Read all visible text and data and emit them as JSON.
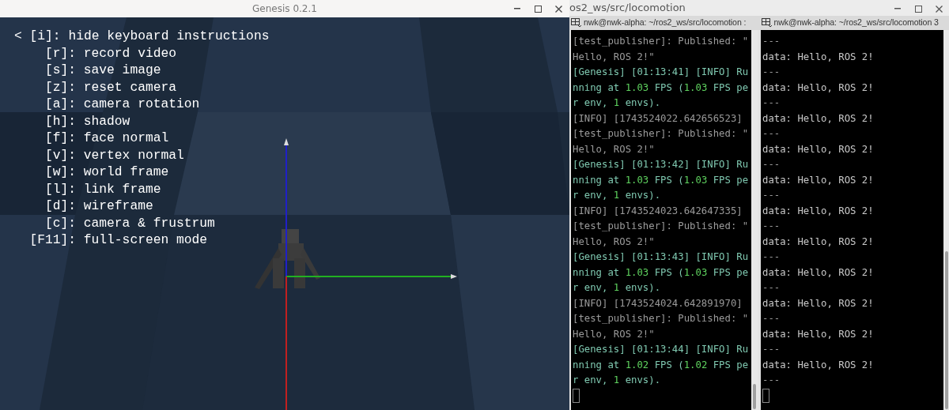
{
  "viewer_window": {
    "title": "Genesis 0.2.1",
    "header": "< [i]: hide keyboard instructions",
    "shortcuts": [
      {
        "key": "[r]:",
        "action": "record video"
      },
      {
        "key": "[s]:",
        "action": "save image"
      },
      {
        "key": "[z]:",
        "action": "reset camera"
      },
      {
        "key": "[a]:",
        "action": "camera rotation"
      },
      {
        "key": "[h]:",
        "action": "shadow"
      },
      {
        "key": "[f]:",
        "action": "face normal"
      },
      {
        "key": "[v]:",
        "action": "vertex normal"
      },
      {
        "key": "[w]:",
        "action": "world frame"
      },
      {
        "key": "[l]:",
        "action": "link frame"
      },
      {
        "key": "[d]:",
        "action": "wireframe"
      },
      {
        "key": "[c]:",
        "action": "camera & frustrum"
      },
      {
        "key": "[F11]:",
        "action": "full-screen mode"
      }
    ]
  },
  "terminal_window": {
    "title": "os2_ws/src/locomotion",
    "tabs": [
      {
        "label": "nwk@nwk-alpha: ~/ros2_ws/src/locomotion :"
      },
      {
        "label": "nwk@nwk-alpha: ~/ros2_ws/src/locomotion 3"
      }
    ],
    "left_pane": [
      [
        {
          "text": "[test_publisher]: Published: \"",
          "kind": "dim"
        }
      ],
      [
        {
          "text": "Hello, ROS 2!\"",
          "kind": "dim"
        }
      ],
      [
        {
          "text": "[Genesis] [01:13:41] [INFO] Ru",
          "kind": "log"
        }
      ],
      [
        {
          "text": "nning at ",
          "kind": "log"
        },
        {
          "text": "1.03",
          "kind": "num"
        },
        {
          "text": " FPS (",
          "kind": "log"
        },
        {
          "text": "1.03",
          "kind": "num"
        },
        {
          "text": " FPS pe",
          "kind": "log"
        }
      ],
      [
        {
          "text": "r env, ",
          "kind": "log"
        },
        {
          "text": "1",
          "kind": "num"
        },
        {
          "text": " envs).",
          "kind": "log"
        }
      ],
      [
        {
          "text": "[INFO] [1743524022.642656523]",
          "kind": "dim"
        }
      ],
      [
        {
          "text": "[test_publisher]: Published: \"",
          "kind": "dim"
        }
      ],
      [
        {
          "text": "Hello, ROS 2!\"",
          "kind": "dim"
        }
      ],
      [
        {
          "text": "[Genesis] [01:13:42] [INFO] Ru",
          "kind": "log"
        }
      ],
      [
        {
          "text": "nning at ",
          "kind": "log"
        },
        {
          "text": "1.03",
          "kind": "num"
        },
        {
          "text": " FPS (",
          "kind": "log"
        },
        {
          "text": "1.03",
          "kind": "num"
        },
        {
          "text": " FPS pe",
          "kind": "log"
        }
      ],
      [
        {
          "text": "r env, ",
          "kind": "log"
        },
        {
          "text": "1",
          "kind": "num"
        },
        {
          "text": " envs).",
          "kind": "log"
        }
      ],
      [
        {
          "text": "[INFO] [1743524023.642647335]",
          "kind": "dim"
        }
      ],
      [
        {
          "text": "[test_publisher]: Published: \"",
          "kind": "dim"
        }
      ],
      [
        {
          "text": "Hello, ROS 2!\"",
          "kind": "dim"
        }
      ],
      [
        {
          "text": "[Genesis] [01:13:43] [INFO] Ru",
          "kind": "log"
        }
      ],
      [
        {
          "text": "nning at ",
          "kind": "log"
        },
        {
          "text": "1.03",
          "kind": "num"
        },
        {
          "text": " FPS (",
          "kind": "log"
        },
        {
          "text": "1.03",
          "kind": "num"
        },
        {
          "text": " FPS pe",
          "kind": "log"
        }
      ],
      [
        {
          "text": "r env, ",
          "kind": "log"
        },
        {
          "text": "1",
          "kind": "num"
        },
        {
          "text": " envs).",
          "kind": "log"
        }
      ],
      [
        {
          "text": "[INFO] [1743524024.642891970]",
          "kind": "dim"
        }
      ],
      [
        {
          "text": "[test_publisher]: Published: \"",
          "kind": "dim"
        }
      ],
      [
        {
          "text": "Hello, ROS 2!\"",
          "kind": "dim"
        }
      ],
      [
        {
          "text": "[Genesis] [01:13:44] [INFO] Ru",
          "kind": "log"
        }
      ],
      [
        {
          "text": "nning at ",
          "kind": "log"
        },
        {
          "text": "1.02",
          "kind": "num"
        },
        {
          "text": " FPS (",
          "kind": "log"
        },
        {
          "text": "1.02",
          "kind": "num"
        },
        {
          "text": " FPS pe",
          "kind": "log"
        }
      ],
      [
        {
          "text": "r env, ",
          "kind": "log"
        },
        {
          "text": "1",
          "kind": "num"
        },
        {
          "text": " envs).",
          "kind": "log"
        }
      ]
    ],
    "right_pane": [
      {
        "text": "---",
        "kind": "dim"
      },
      {
        "text": "data: Hello, ROS 2!",
        "kind": "plain"
      },
      {
        "text": "---",
        "kind": "dim"
      },
      {
        "text": "data: Hello, ROS 2!",
        "kind": "plain"
      },
      {
        "text": "---",
        "kind": "dim"
      },
      {
        "text": "data: Hello, ROS 2!",
        "kind": "plain"
      },
      {
        "text": "---",
        "kind": "dim"
      },
      {
        "text": "data: Hello, ROS 2!",
        "kind": "plain"
      },
      {
        "text": "---",
        "kind": "dim"
      },
      {
        "text": "data: Hello, ROS 2!",
        "kind": "plain"
      },
      {
        "text": "---",
        "kind": "dim"
      },
      {
        "text": "data: Hello, ROS 2!",
        "kind": "plain"
      },
      {
        "text": "---",
        "kind": "dim"
      },
      {
        "text": "data: Hello, ROS 2!",
        "kind": "plain"
      },
      {
        "text": "---",
        "kind": "dim"
      },
      {
        "text": "data: Hello, ROS 2!",
        "kind": "plain"
      },
      {
        "text": "---",
        "kind": "dim"
      },
      {
        "text": "data: Hello, ROS 2!",
        "kind": "plain"
      },
      {
        "text": "---",
        "kind": "dim"
      },
      {
        "text": "data: Hello, ROS 2!",
        "kind": "plain"
      },
      {
        "text": "---",
        "kind": "dim"
      },
      {
        "text": "data: Hello, ROS 2!",
        "kind": "plain"
      },
      {
        "text": "---",
        "kind": "dim"
      }
    ]
  }
}
